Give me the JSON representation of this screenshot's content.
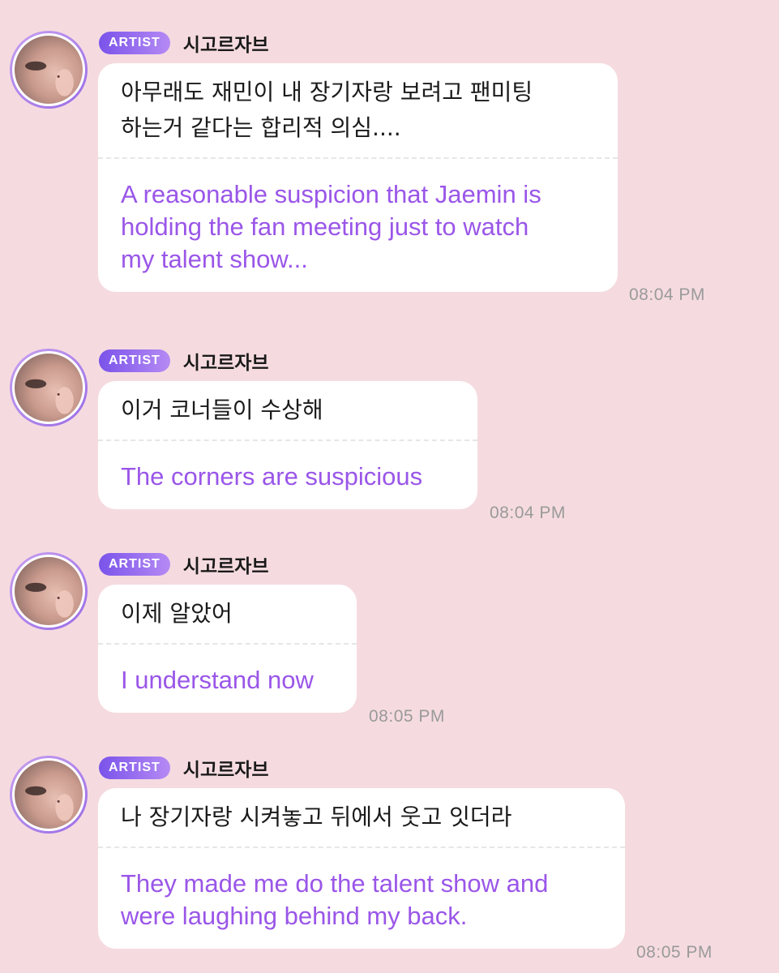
{
  "messages": [
    {
      "badge": "ARTIST",
      "name": "시고르자브",
      "korean": "아무래도 재민이 내 장기자랑 보려고 팬미팅\n하는거 같다는 합리적 의심....",
      "english": "A reasonable suspicion that Jaemin is\nholding the fan meeting just to watch\nmy talent show...",
      "time": "08:04 PM"
    },
    {
      "badge": "ARTIST",
      "name": "시고르자브",
      "korean": "이거 코너들이 수상해",
      "english": "The corners are suspicious",
      "time": "08:04 PM"
    },
    {
      "badge": "ARTIST",
      "name": "시고르자브",
      "korean": "이제 알았어",
      "english": "I understand now",
      "time": "08:05 PM"
    },
    {
      "badge": "ARTIST",
      "name": "시고르자브",
      "korean": "나 장기자랑 시켜놓고 뒤에서 웃고 잇더라",
      "english": "They made me do the talent show and\nwere laughing behind my back.",
      "time": "08:05 PM"
    }
  ]
}
